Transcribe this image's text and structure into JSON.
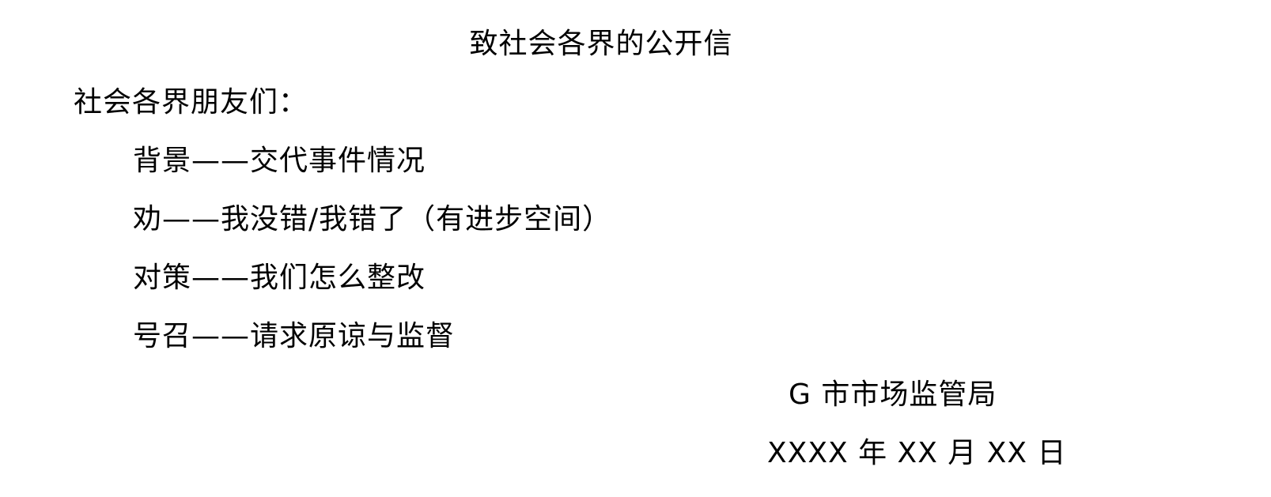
{
  "document": {
    "title": "致社会各界的公开信",
    "salutation": "社会各界朋友们：",
    "items": [
      "背景——交代事件情况",
      "劝——我没错/我错了（有进步空间）",
      "对策——我们怎么整改",
      "号召——请求原谅与监督"
    ],
    "signature": "G 市市场监管局",
    "date": "XXXX 年 XX 月 XX 日"
  }
}
